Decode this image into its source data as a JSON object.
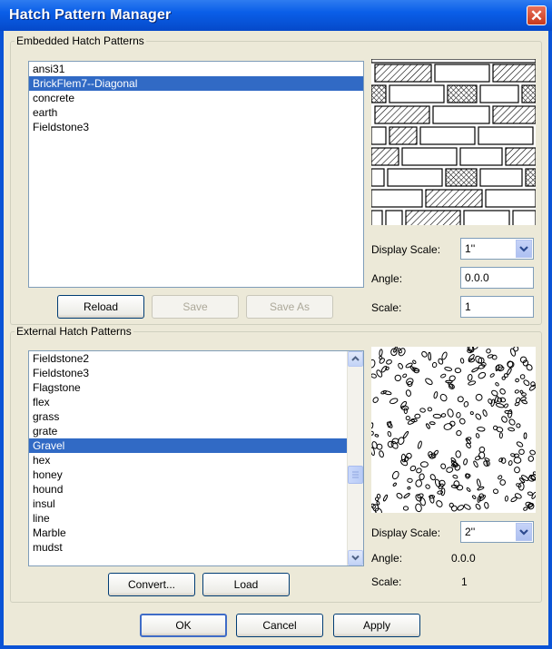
{
  "window": {
    "title": "Hatch Pattern Manager",
    "close_glyph": "✕"
  },
  "embedded": {
    "group_label": "Embedded Hatch Patterns",
    "items": [
      "ansi31",
      "BrickFlem7--Diagonal",
      "concrete",
      "earth",
      "Fieldstone3"
    ],
    "selected_index": 1,
    "buttons": {
      "reload": "Reload",
      "save": "Save",
      "save_as": "Save As"
    },
    "display_scale_label": "Display Scale:",
    "display_scale_value": "1''",
    "angle_label": "Angle:",
    "angle_value": "0.0.0",
    "scale_label": "Scale:",
    "scale_value": "1"
  },
  "external": {
    "group_label": "External Hatch Patterns",
    "items": [
      "Fieldstone2",
      "Fieldstone3",
      "Flagstone",
      "flex",
      "grass",
      "grate",
      "Gravel",
      "hex",
      "honey",
      "hound",
      "insul",
      "line",
      "Marble",
      "mudst"
    ],
    "selected_index": 6,
    "buttons": {
      "convert": "Convert...",
      "load": "Load"
    },
    "display_scale_label": "Display Scale:",
    "display_scale_value": "2''",
    "angle_label": "Angle:",
    "angle_value": "0.0.0",
    "scale_label": "Scale:",
    "scale_value": "1"
  },
  "footer": {
    "ok": "OK",
    "cancel": "Cancel",
    "apply": "Apply"
  },
  "icons": {
    "close": "close-icon",
    "dropdown": "chevron-down-icon",
    "scroll_up": "scroll-up-icon",
    "scroll_down": "scroll-down-icon"
  }
}
